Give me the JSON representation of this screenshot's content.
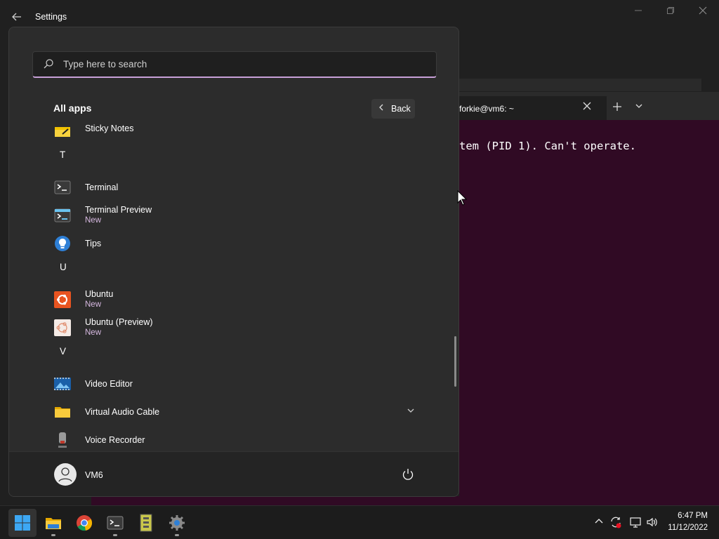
{
  "window": {
    "title": "Settings",
    "back_icon": "back-arrow-icon",
    "controls": [
      "minimize-icon",
      "restore-icon",
      "close-icon"
    ]
  },
  "terminal": {
    "tab_title": "forkie@vm6: ~",
    "output_line": "tem (PID 1). Can't operate.",
    "background": "#300a24"
  },
  "start_menu": {
    "search_placeholder": "Type here to search",
    "heading": "All apps",
    "back_label": "Back",
    "items": [
      {
        "type": "app",
        "name": "Sticky Notes",
        "icon": "sticky-notes-icon"
      },
      {
        "type": "letter",
        "name": "T"
      },
      {
        "type": "app",
        "name": "Terminal",
        "icon": "terminal-icon"
      },
      {
        "type": "app",
        "name": "Terminal Preview",
        "sub": "New",
        "icon": "terminal-preview-icon"
      },
      {
        "type": "app",
        "name": "Tips",
        "icon": "tips-icon"
      },
      {
        "type": "letter",
        "name": "U"
      },
      {
        "type": "app",
        "name": "Ubuntu",
        "sub": "New",
        "icon": "ubuntu-icon"
      },
      {
        "type": "app",
        "name": "Ubuntu (Preview)",
        "sub": "New",
        "icon": "ubuntu-preview-icon"
      },
      {
        "type": "letter",
        "name": "V"
      },
      {
        "type": "app",
        "name": "Video Editor",
        "icon": "video-editor-icon"
      },
      {
        "type": "app",
        "name": "Virtual Audio Cable",
        "icon": "folder-icon",
        "expandable": true
      },
      {
        "type": "app",
        "name": "Voice Recorder",
        "icon": "voice-recorder-icon"
      }
    ],
    "user_name": "VM6",
    "accent": "#c8a0d8"
  },
  "taskbar": {
    "apps": [
      "start-icon",
      "file-explorer-icon",
      "chrome-icon",
      "terminal-icon",
      "archive-icon",
      "settings-icon"
    ],
    "tray": [
      "chevron-up-icon",
      "sync-alert-icon",
      "network-icon",
      "volume-icon"
    ],
    "time": "6:47 PM",
    "date": "11/12/2022"
  }
}
